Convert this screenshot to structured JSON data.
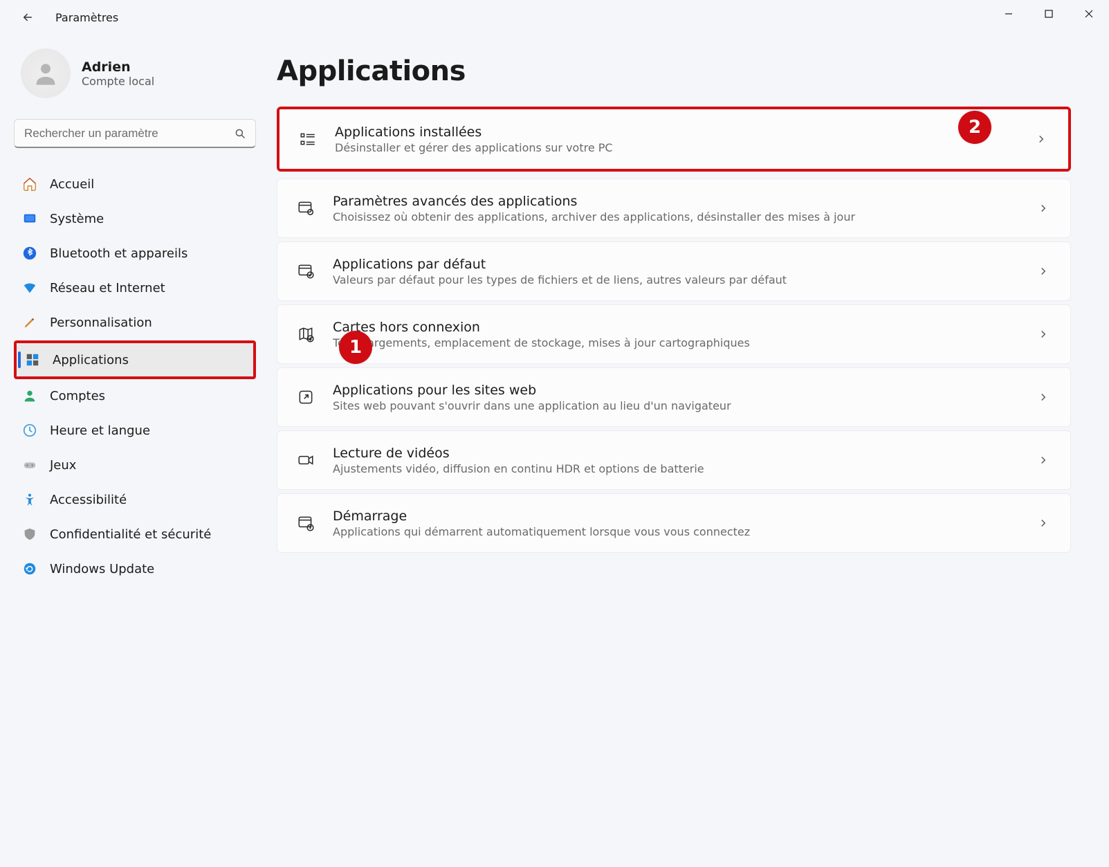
{
  "window": {
    "title": "Paramètres"
  },
  "user": {
    "name": "Adrien",
    "sub": "Compte local"
  },
  "search": {
    "placeholder": "Rechercher un paramètre"
  },
  "sidebar": {
    "items": [
      {
        "label": "Accueil"
      },
      {
        "label": "Système"
      },
      {
        "label": "Bluetooth et appareils"
      },
      {
        "label": "Réseau et Internet"
      },
      {
        "label": "Personnalisation"
      },
      {
        "label": "Applications"
      },
      {
        "label": "Comptes"
      },
      {
        "label": "Heure et langue"
      },
      {
        "label": "Jeux"
      },
      {
        "label": "Accessibilité"
      },
      {
        "label": "Confidentialité et sécurité"
      },
      {
        "label": "Windows Update"
      }
    ],
    "selected_index": 5
  },
  "page": {
    "title": "Applications"
  },
  "cards": [
    {
      "title": "Applications installées",
      "sub": "Désinstaller et gérer des applications sur votre PC"
    },
    {
      "title": "Paramètres avancés des applications",
      "sub": "Choisissez où obtenir des applications, archiver des applications, désinstaller des mises à jour"
    },
    {
      "title": "Applications par défaut",
      "sub": "Valeurs par défaut pour les types de fichiers et de liens, autres valeurs par défaut"
    },
    {
      "title": "Cartes hors connexion",
      "sub": "Téléchargements, emplacement de stockage, mises à jour cartographiques"
    },
    {
      "title": "Applications pour les sites web",
      "sub": "Sites web pouvant s'ouvrir dans une application au lieu d'un navigateur"
    },
    {
      "title": "Lecture de vidéos",
      "sub": "Ajustements vidéo, diffusion en continu HDR et options de batterie"
    },
    {
      "title": "Démarrage",
      "sub": "Applications qui démarrent automatiquement lorsque vous vous connectez"
    }
  ],
  "annotations": {
    "badge1": "1",
    "badge2": "2"
  }
}
